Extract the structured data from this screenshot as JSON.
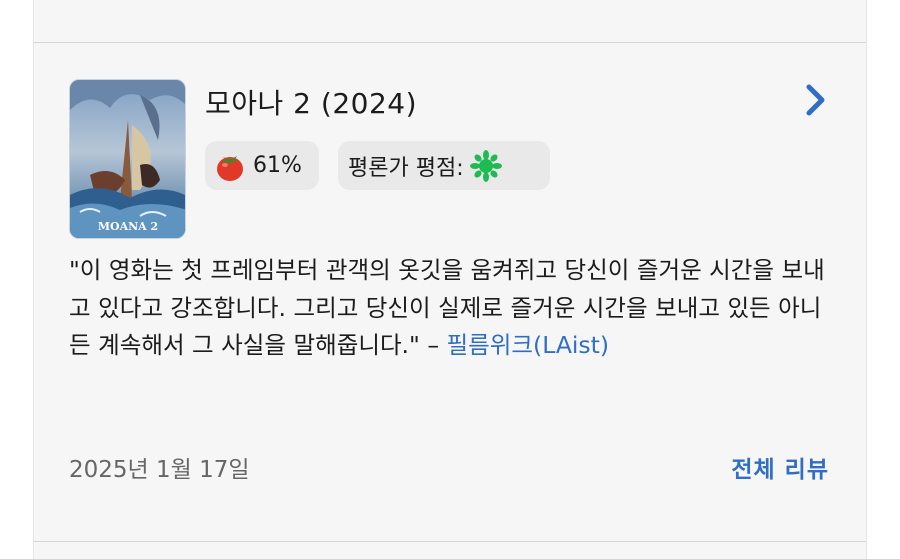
{
  "movie": {
    "title": "모아나 2 (2024)",
    "poster_caption": "MOANA 2"
  },
  "score": {
    "icon": "tomato-icon",
    "value": "61%"
  },
  "critic": {
    "label": "평론가 평점:",
    "icon": "green-splat-icon"
  },
  "review": {
    "quote": "\"이 영화는 첫 프레임부터 관객의 옷깃을 움켜쥐고 당신이 즐거운 시간을 보내고 있다고 강조합니다. 그리고 당신이 실제로 즐거운 시간을 보내고 있든 아니든 계속해서 그 사실을 말해줍니다.\"",
    "dash": " – ",
    "source": "필름위크(LAist)"
  },
  "footer": {
    "date": "2025년 1월 17일",
    "all_reviews": "전체 리뷰"
  },
  "colors": {
    "accent": "#2f6ec4",
    "tomato": "#e0392a",
    "splat": "#1dbb52"
  }
}
